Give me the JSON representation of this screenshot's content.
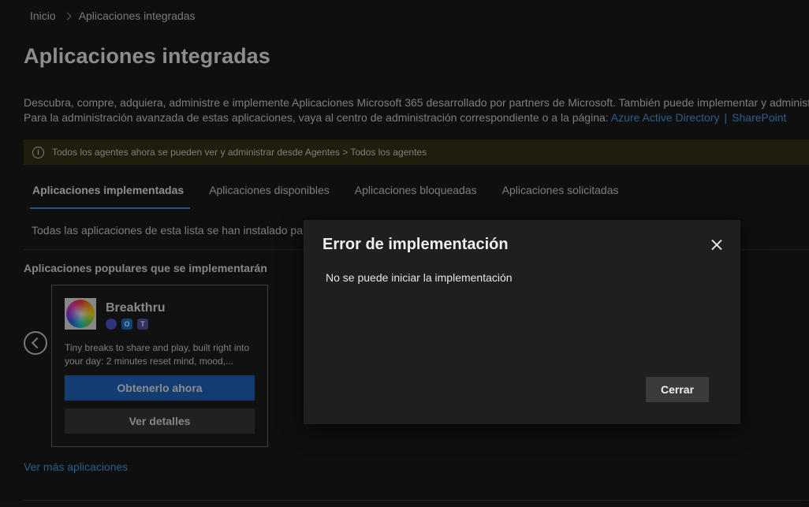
{
  "breadcrumb": {
    "home": "Inicio",
    "current": "Aplicaciones integradas"
  },
  "page_title": "Aplicaciones integradas",
  "description": {
    "line1": "Descubra, compre, adquiera, administre e implemente Aplicaciones Microsoft 365 desarrollado por partners de Microsoft. También puede implementar y administr",
    "line2_prefix": "Para la administración avanzada de estas aplicaciones, vaya al centro de administración correspondiente o a la página:",
    "link1": "Azure Active Directory",
    "separator": "|",
    "link2": "SharePoint"
  },
  "info_bar": {
    "text": "Todos los agentes ahora se pueden ver y administrar desde Agentes > Todos los agentes",
    "icon": "info-icon"
  },
  "tabs": [
    {
      "label": "Aplicaciones implementadas",
      "active": true
    },
    {
      "label": "Aplicaciones disponibles",
      "active": false
    },
    {
      "label": "Aplicaciones bloqueadas",
      "active": false
    },
    {
      "label": "Aplicaciones solicitadas",
      "active": false
    }
  ],
  "list_description": "Todas las aplicaciones de esta lista se han instalado para",
  "popular": {
    "title": "Aplicaciones populares que se implementarán",
    "card": {
      "name": "Breakthru",
      "description": "Tiny breaks to share and play, built right into your day: 2 minutes reset mind, mood,...",
      "primary_button": "Obtenerlo ahora",
      "secondary_button": "Ver detalles",
      "icons": [
        "copilot-icon",
        "outlook-icon",
        "teams-icon"
      ]
    },
    "more_link": "Ver más aplicaciones"
  },
  "dialog": {
    "title": "Error de implementación",
    "message": "No se puede iniciar la implementación",
    "close_button": "Cerrar"
  },
  "colors": {
    "accent": "#1f68c4",
    "link": "#4aa0ea",
    "info_bg": "#3a3218",
    "background": "#1b1b1b"
  }
}
